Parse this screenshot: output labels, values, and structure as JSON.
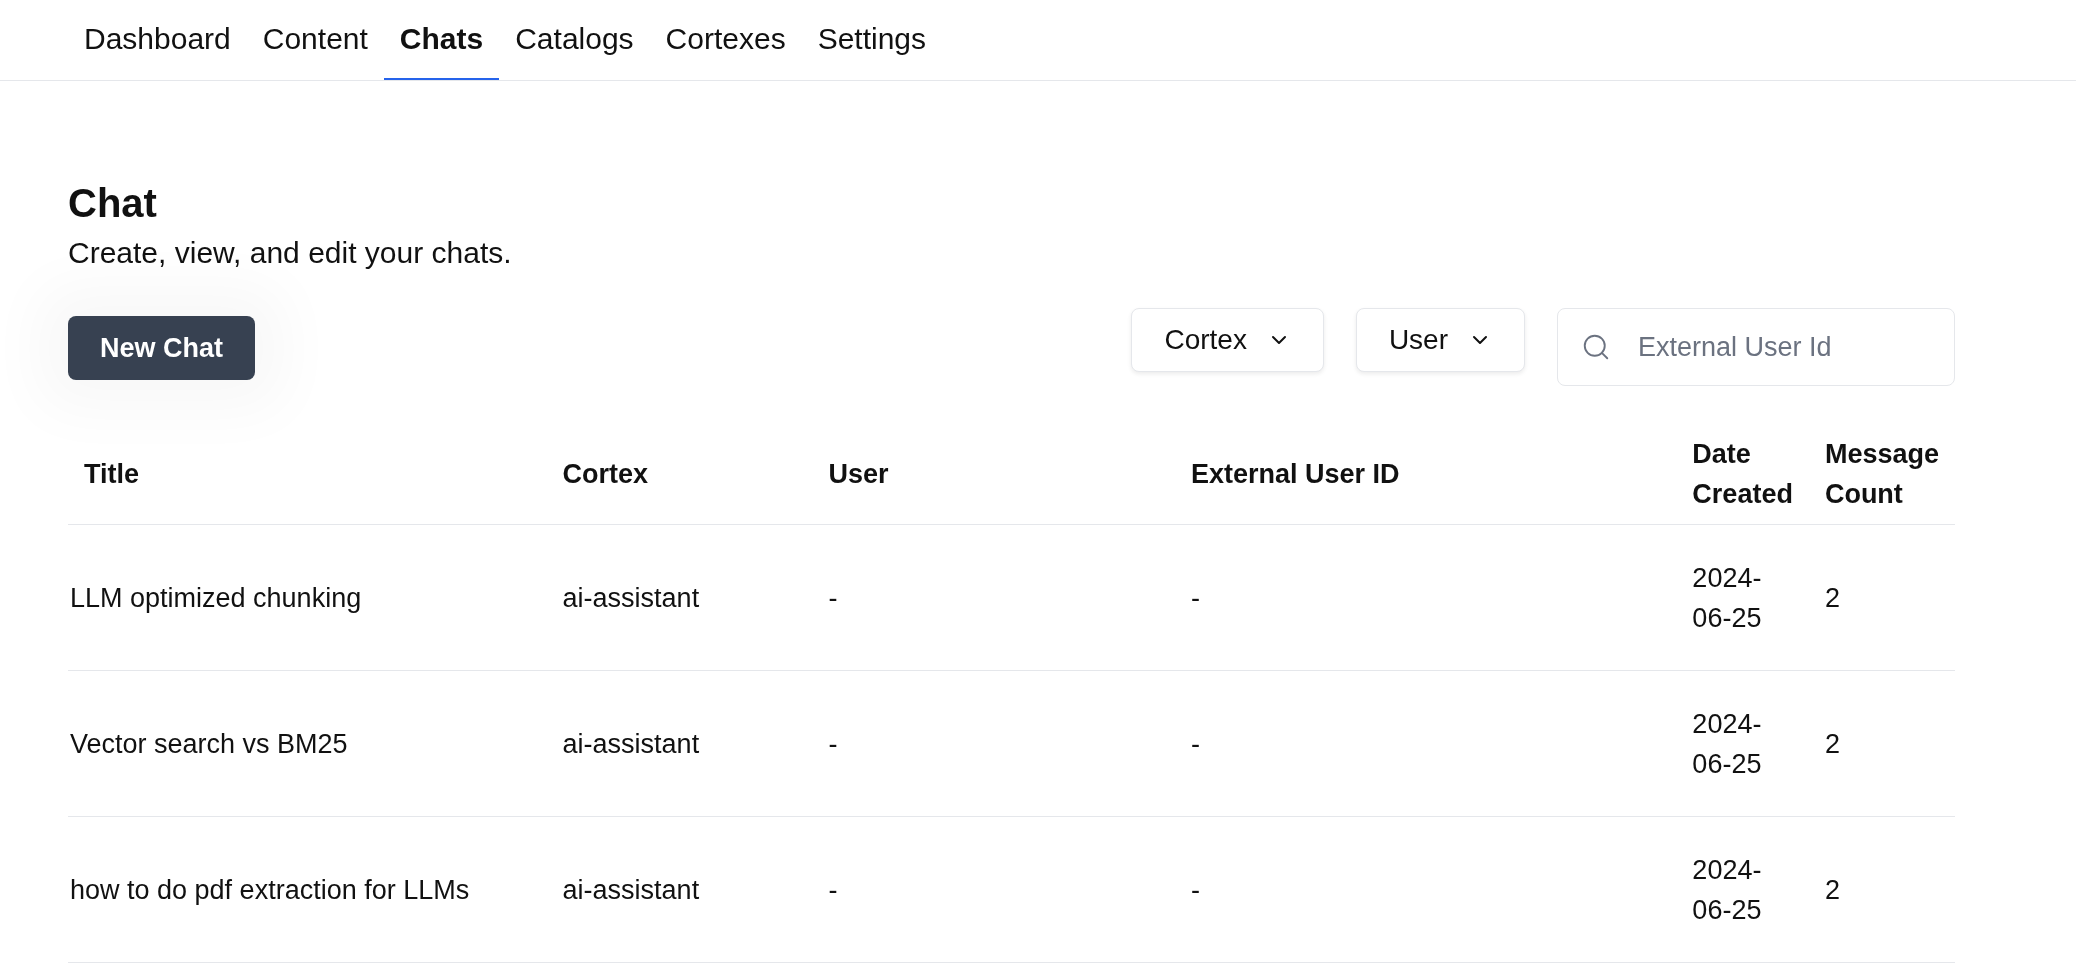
{
  "tabs": [
    {
      "label": "Dashboard",
      "selected": false
    },
    {
      "label": "Content",
      "selected": false
    },
    {
      "label": "Chats",
      "selected": true
    },
    {
      "label": "Catalogs",
      "selected": false
    },
    {
      "label": "Cortexes",
      "selected": false
    },
    {
      "label": "Settings",
      "selected": false
    }
  ],
  "page": {
    "title": "Chat",
    "subtitle": "Create, view, and edit your chats."
  },
  "new_button": "New Chat",
  "filters": [
    "Cortex",
    "User"
  ],
  "search": {
    "placeholder": "External User Id"
  },
  "table": {
    "columns": [
      "Title",
      "Cortex",
      "User",
      "External User ID",
      "Date Created",
      "Message Count"
    ],
    "rows": [
      [
        "LLM optimized chunking",
        "ai-assistant",
        "-",
        "-",
        "2024-06-25",
        "2"
      ],
      [
        "Vector search vs BM25",
        "ai-assistant",
        "-",
        "-",
        "2024-06-25",
        "2"
      ],
      [
        "how to do pdf extraction for LLMs",
        "ai-assistant",
        "-",
        "-",
        "2024-06-25",
        "2"
      ]
    ]
  }
}
